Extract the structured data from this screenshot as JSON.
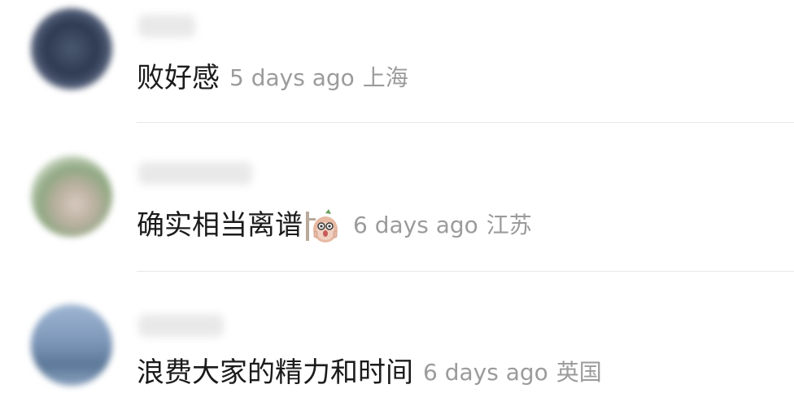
{
  "comments": [
    {
      "text": "败好感",
      "time": "5 days ago",
      "location": "上海"
    },
    {
      "text": "确实相当离谱",
      "sticker": "surprised-bean-sticker",
      "time": "6 days ago",
      "location": "江苏"
    },
    {
      "text": "浪费大家的精力和时间",
      "time": "6 days ago",
      "location": "英国"
    }
  ]
}
